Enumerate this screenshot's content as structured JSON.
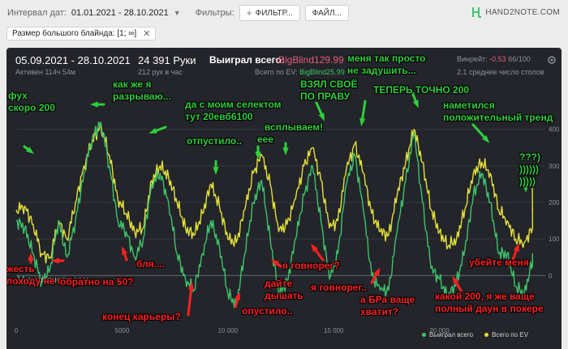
{
  "filters_bar": {
    "date_label": "Интервал дат:",
    "date_range": "01.01.2021 - 28.10.2021",
    "filters_label": "Фильтры:",
    "filter_button": "ФИЛЬТР...",
    "file_button": "ФАЙЛ...",
    "brand": "HAND2NOTE.COM"
  },
  "active_filter": {
    "label": "Размер большого блайнда: [1; ∞]"
  },
  "summary": {
    "dates": "05.09.2021 - 28.10.2021",
    "active": "Активен 114ч 54м",
    "hands": "24 391 Руки",
    "hands_per_hour": "212 рук в час",
    "won_label": "Выиграл всего:",
    "won_value": "-BigBlind129.99",
    "ev_label": "Всего по EV: ",
    "ev_value": "BigBlind25.99",
    "winrate_label": "Винрейт: ",
    "winrate_value": "-0.53",
    "winrate_suffix": " 66/100",
    "tables": "2.1 среднее число столов"
  },
  "watermark": "HAND2NOTE.COM",
  "legend": {
    "won": "Выиграл всего",
    "ev": "Всего по EV"
  },
  "colors": {
    "won": "#3ec36a",
    "ev": "#e2e03a",
    "red_note": "#ff2020",
    "green_note": "#2ecf3c",
    "negative": "#e65b7b"
  },
  "chart_data": {
    "type": "line",
    "xlim": [
      0,
      25000
    ],
    "ylim": [
      -130,
      530
    ],
    "x_ticks": [
      0,
      5000,
      10000,
      15000,
      20000
    ],
    "x_tick_labels": [
      "0",
      "5000",
      "10 000",
      "15 000",
      "20 000"
    ],
    "y_ticks": [
      0,
      100,
      200,
      300,
      400
    ],
    "y_tick_labels": [
      "0",
      "100",
      "200",
      "300",
      "400"
    ],
    "series": [
      {
        "name": "Выиграл всего",
        "x": [
          0,
          400,
          800,
          1200,
          1600,
          2000,
          2400,
          2800,
          3200,
          3600,
          4000,
          4400,
          4800,
          5200,
          5600,
          6000,
          6400,
          6800,
          7200,
          7600,
          8000,
          8400,
          8800,
          9200,
          9600,
          10000,
          10400,
          10800,
          11200,
          11600,
          12000,
          12400,
          12800,
          13200,
          13600,
          14000,
          14400,
          14800,
          15200,
          15600,
          16000,
          16400,
          16800,
          17200,
          17600,
          18000,
          18400,
          18800,
          19200,
          19600,
          20000,
          20400,
          20800,
          21200,
          21600,
          22000,
          22400,
          22800,
          23200,
          23600,
          24000,
          24400,
          24391
        ],
        "values": [
          150,
          130,
          60,
          -20,
          20,
          150,
          50,
          150,
          280,
          380,
          420,
          300,
          150,
          120,
          50,
          100,
          250,
          280,
          200,
          60,
          -10,
          -40,
          60,
          150,
          80,
          -50,
          -80,
          60,
          200,
          260,
          100,
          -50,
          -20,
          100,
          220,
          300,
          150,
          -10,
          60,
          250,
          330,
          180,
          0,
          -40,
          -40,
          120,
          260,
          390,
          200,
          20,
          -10,
          -60,
          -20,
          70,
          220,
          280,
          200,
          60,
          60,
          -30,
          -50,
          40,
          40
        ]
      },
      {
        "name": "Всего по EV",
        "x": [
          0,
          400,
          800,
          1200,
          1600,
          2000,
          2400,
          2800,
          3200,
          3600,
          4000,
          4400,
          4800,
          5200,
          5600,
          6000,
          6400,
          6800,
          7200,
          7600,
          8000,
          8400,
          8800,
          9200,
          9600,
          10000,
          10400,
          10800,
          11200,
          11600,
          12000,
          12400,
          12800,
          13200,
          13600,
          14000,
          14400,
          14800,
          15200,
          15600,
          16000,
          16400,
          16800,
          17200,
          17600,
          18000,
          18400,
          18800,
          19200,
          19600,
          20000,
          20400,
          20800,
          21200,
          21600,
          22000,
          22400,
          22800,
          23200,
          23600,
          24000,
          24400,
          24391
        ],
        "values": [
          180,
          190,
          140,
          60,
          50,
          150,
          100,
          200,
          300,
          370,
          410,
          330,
          210,
          170,
          120,
          130,
          260,
          300,
          270,
          200,
          130,
          110,
          170,
          250,
          190,
          100,
          90,
          180,
          280,
          330,
          250,
          120,
          140,
          210,
          300,
          350,
          260,
          130,
          150,
          290,
          360,
          280,
          170,
          120,
          110,
          220,
          310,
          400,
          310,
          180,
          120,
          80,
          100,
          180,
          280,
          310,
          280,
          180,
          150,
          100,
          90,
          130,
          240
        ]
      }
    ]
  },
  "annotations": {
    "fuh": "фух\nскоро 200",
    "razryv": "как же я\nразрываю...",
    "selekt": "да с моим селектом\nтут 20евб6100",
    "otpustilo1": "отпустило..",
    "eee": "еее",
    "vsplyvaem": "всплываем!",
    "vzyal": "ВЗЯЛ СВОЁ\nПО ПРАВУ",
    "menya": "меня так просто\nне задушить...",
    "tochno": "ТЕПЕРЬ ТОЧНО 200",
    "trend": "наметился\nположительный тренд",
    "qqq": "???)\n))))))\n)))))",
    "zhest": "жесть\nпоходу не гожусь",
    "obratno": "обратно на 50?",
    "blya": "бля....",
    "konec": "конец карьеры?",
    "opustilo": "опустило..",
    "dayte": "дайте\nдышать",
    "govnoreg1": "я говнорег?",
    "govnoreg2": "я говнорег..",
    "bra": "а БРа ваще\nхватит?",
    "kakoy": "какой 200, я же ваще\nполный даун в покере",
    "ubeyte": "убейте меня"
  }
}
